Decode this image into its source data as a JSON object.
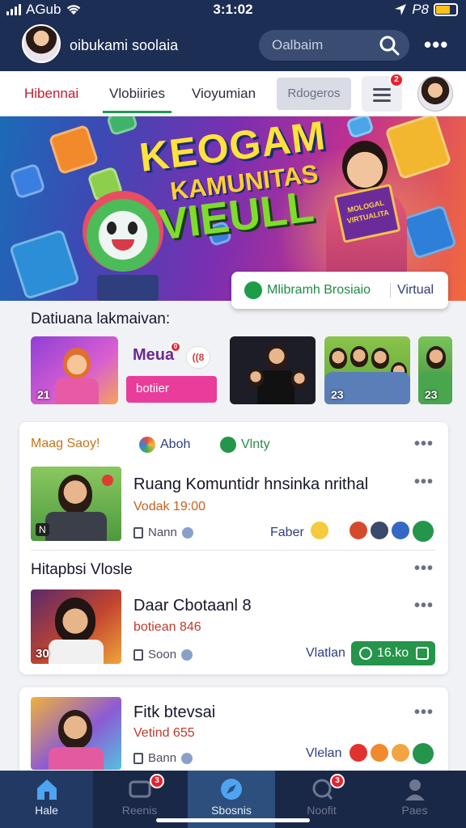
{
  "status": {
    "carrier": "AGub",
    "time": "3:1:02",
    "right_text": "P8"
  },
  "header": {
    "title": "oibukami soolaia",
    "search_placeholder": "Oalbaim",
    "more_label": "•••"
  },
  "tabs": [
    {
      "label": "Hibennai"
    },
    {
      "label": "Vlobiiries"
    },
    {
      "label": "Vioyumian"
    },
    {
      "label": "Rdogeros"
    }
  ],
  "tab_menu_badge": "2",
  "banner": {
    "line1": "KEOGAM",
    "line2": "KAMUNITAS",
    "line3": "VIEULL",
    "sign_text": "MOLOGAL VIRTUALITA",
    "pill_left": "Mlibramh Brosiaio",
    "pill_right": "Virtual"
  },
  "stories": {
    "title": "Datiuana lakmaivan:",
    "first_num": "21",
    "mega_label": "Meua",
    "mega_badge": "0",
    "mega_circle": "((8",
    "mega_button": "botiier",
    "nums": [
      "",
      "23",
      "23"
    ]
  },
  "card1": {
    "chips": [
      "Maag Saoy!",
      "Aboh",
      "Vlnty"
    ],
    "post1": {
      "title": "Ruang Komuntidr hnsinka nrithal",
      "sub": "Vodak 19:00",
      "meta": "Nann",
      "react_label": "Faber",
      "thumb_num": "N"
    },
    "section": "Hitapbsi Vlosle",
    "post2": {
      "title": "Daar Cbotaanl 8",
      "sub": "botiean 846",
      "meta": "Soon",
      "react_label": "Vlatlan",
      "button": "16.ko",
      "thumb_num": "30"
    }
  },
  "card2": {
    "post": {
      "title": "Fitk btevsai",
      "sub": "Vetind 655",
      "meta": "Bann",
      "react_label": "Vlelan"
    }
  },
  "nav": [
    {
      "label": "Hale",
      "badge": ""
    },
    {
      "label": "Reenis",
      "badge": "3"
    },
    {
      "label": "Sbosnis",
      "badge": ""
    },
    {
      "label": "Noofit",
      "badge": "3"
    },
    {
      "label": "Paes",
      "badge": ""
    }
  ],
  "colors": {
    "header": "#1d2e54",
    "accent_green": "#24954a",
    "accent_red": "#c51b2e",
    "nav": "#1a2847"
  }
}
